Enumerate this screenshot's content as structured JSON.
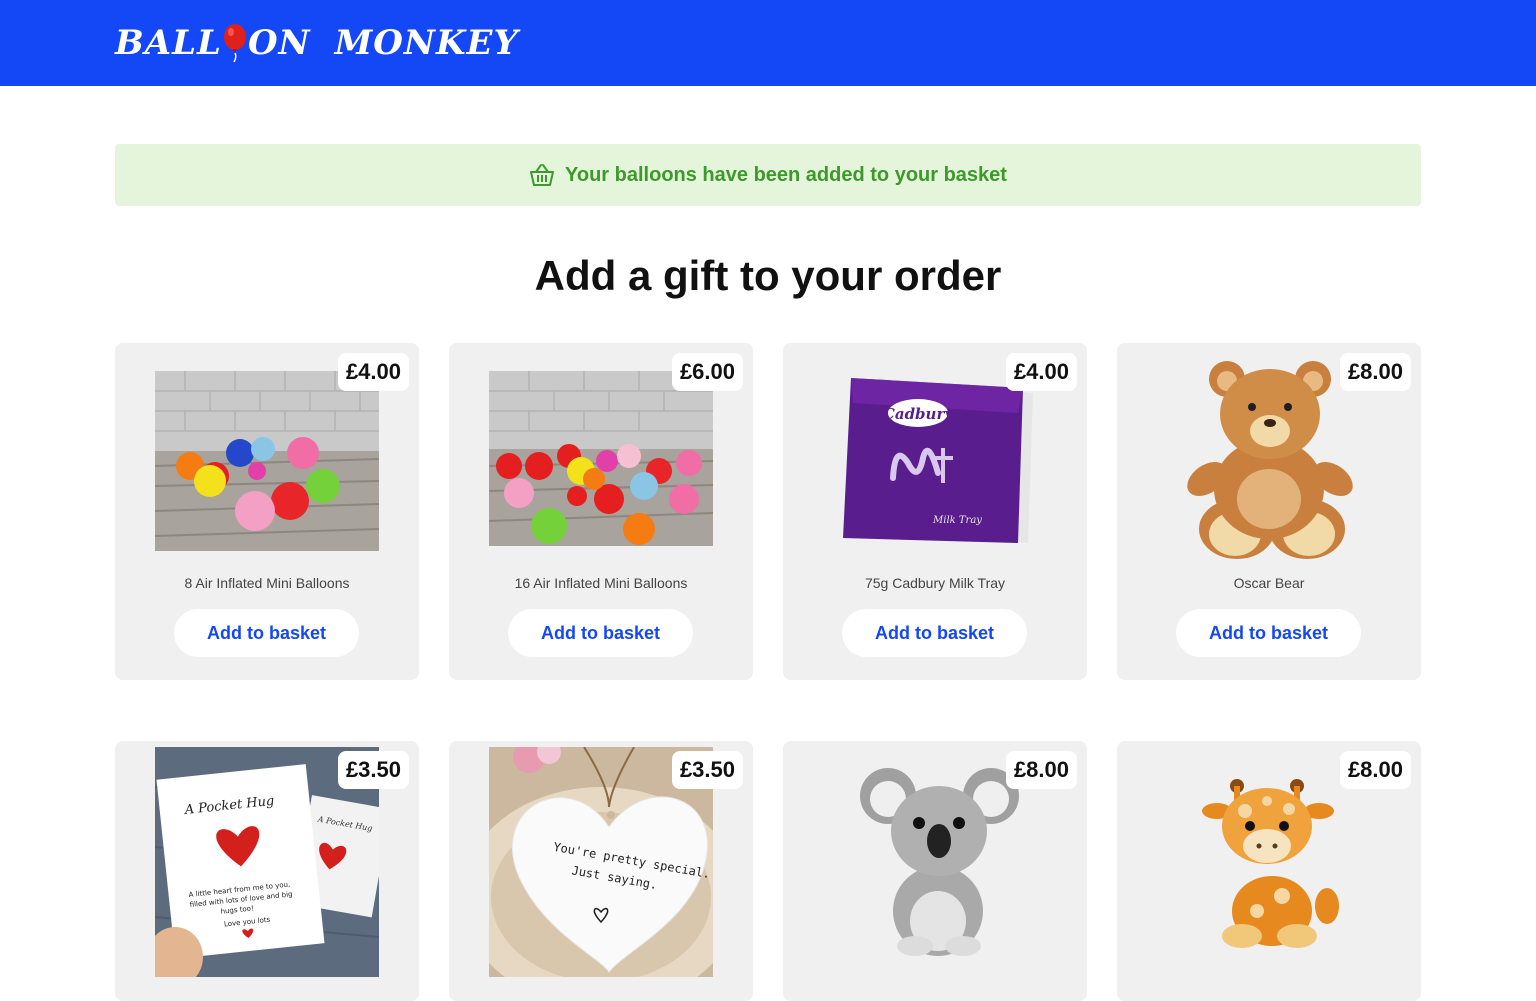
{
  "brand": {
    "word1_a": "BALL",
    "word1_b": "ON",
    "word2": "MONKEY",
    "balloon_color": "#e0201b",
    "header_color": "#1447f5"
  },
  "alert": {
    "icon": "basket-icon",
    "message": "Your balloons have been added to your basket"
  },
  "heading": "Add a gift to your order",
  "products": [
    {
      "name": "8 Air Inflated Mini Balloons",
      "price": "£4.00",
      "button": "Add to basket"
    },
    {
      "name": "16 Air Inflated Mini Balloons",
      "price": "£6.00",
      "button": "Add to basket"
    },
    {
      "name": "75g Cadbury Milk Tray",
      "price": "£4.00",
      "button": "Add to basket"
    },
    {
      "name": "Oscar Bear",
      "price": "£8.00",
      "button": "Add to basket"
    },
    {
      "price": "£3.50"
    },
    {
      "price": "£3.50"
    },
    {
      "price": "£8.00"
    },
    {
      "price": "£8.00"
    }
  ],
  "image_text": {
    "cadbury": "Cadbury",
    "milktray": "Milk Tray",
    "hug_title": "A Pocket Hug",
    "hug_title_small": "A Pocket Hug",
    "hug_line1": "A little heart from me to you,",
    "hug_line2": "filled with lots of love and big",
    "hug_line3": "hugs too!",
    "hug_line4": "Love you lots",
    "heart_line1": "You're pretty special.",
    "heart_line2": "Just saying."
  }
}
